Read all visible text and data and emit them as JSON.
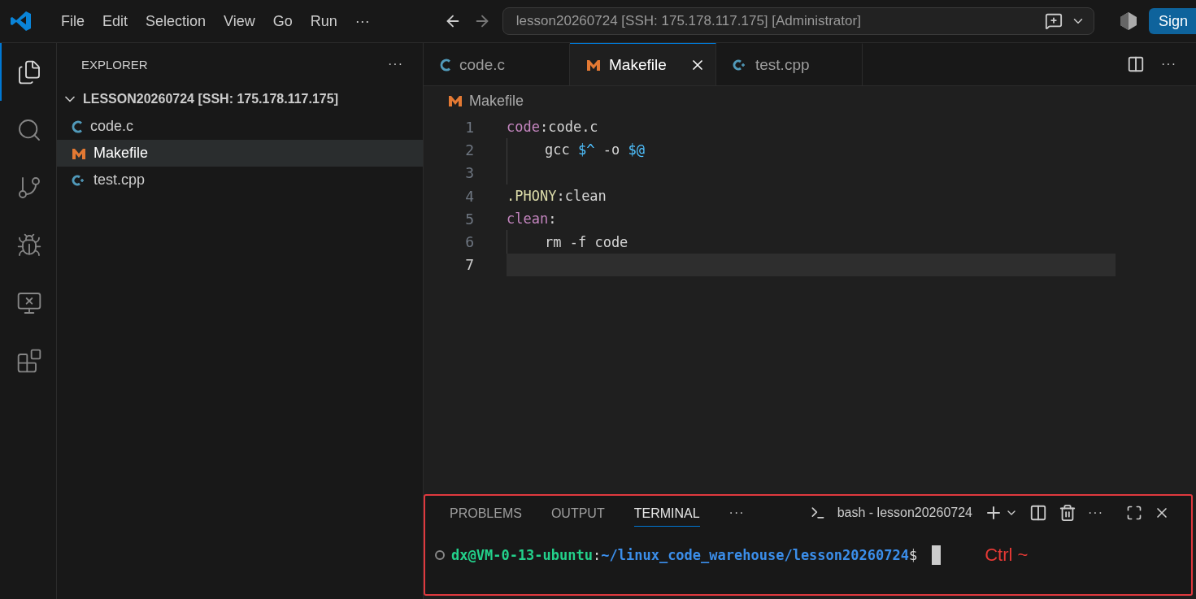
{
  "title_bar": {
    "menu": [
      "File",
      "Edit",
      "Selection",
      "View",
      "Go",
      "Run",
      "···"
    ],
    "command_center": "lesson20260724 [SSH: 175.178.117.175] [Administrator]",
    "sign_in": "Sign"
  },
  "activity_bar": [
    {
      "kind": "explorer",
      "selected": true
    },
    {
      "kind": "search",
      "selected": false
    },
    {
      "kind": "source-control",
      "selected": false
    },
    {
      "kind": "run-debug",
      "selected": false
    },
    {
      "kind": "remote",
      "selected": false
    },
    {
      "kind": "extensions",
      "selected": false
    }
  ],
  "sidebar": {
    "title": "EXPLORER",
    "more": "···",
    "folder": {
      "label": "LESSON20260724 [SSH: 175.178.117.175]",
      "expanded": true,
      "children": [
        {
          "label": "code.c",
          "kind": "c",
          "selected": false
        },
        {
          "label": "Makefile",
          "kind": "make",
          "selected": true
        },
        {
          "label": "test.cpp",
          "kind": "cpp",
          "selected": false
        }
      ]
    }
  },
  "editor": {
    "tabs": [
      {
        "label": "code.c",
        "kind": "c",
        "selected": false
      },
      {
        "label": "Makefile",
        "kind": "make",
        "selected": true
      },
      {
        "label": "test.cpp",
        "kind": "cpp",
        "selected": false
      }
    ],
    "more": "···",
    "breadcrumb": {
      "label": "Makefile",
      "kind": "make"
    },
    "lines": [
      {
        "number": "1",
        "indented": false,
        "current": false,
        "tokens": [
          {
            "text": "code",
            "kind": "target"
          },
          {
            "text": ":code.c",
            "kind": "plain"
          }
        ]
      },
      {
        "number": "2",
        "indented": true,
        "current": false,
        "tokens": [
          {
            "text": "gcc ",
            "kind": "plain"
          },
          {
            "text": "$^",
            "kind": "var"
          },
          {
            "text": " -o ",
            "kind": "plain"
          },
          {
            "text": "$@",
            "kind": "var"
          }
        ]
      },
      {
        "number": "3",
        "indented": true,
        "current": false
      },
      {
        "number": "4",
        "indented": false,
        "current": false,
        "tokens": [
          {
            "text": ".PHONY",
            "kind": "special"
          },
          {
            "text": ":clean",
            "kind": "plain"
          }
        ]
      },
      {
        "number": "5",
        "indented": false,
        "current": false,
        "tokens": [
          {
            "text": "clean",
            "kind": "target"
          },
          {
            "text": ":",
            "kind": "plain"
          }
        ]
      },
      {
        "number": "6",
        "indented": true,
        "current": false,
        "tokens": [
          {
            "text": "rm -f code",
            "kind": "plain"
          }
        ]
      },
      {
        "number": "7",
        "indented": false,
        "current": true
      }
    ]
  },
  "panel": {
    "tabs": [
      {
        "label": "PROBLEMS",
        "selected": false
      },
      {
        "label": "OUTPUT",
        "selected": false
      },
      {
        "label": "TERMINAL",
        "selected": true
      }
    ],
    "more": "···",
    "terminal_name": "bash - lesson20260724",
    "actions_more": "···",
    "prompt": [
      {
        "text": "dx@VM-0-13-ubuntu",
        "kind": "user"
      },
      {
        "text": ":",
        "kind": "plain"
      },
      {
        "text": "~/linux_code_warehouse/lesson20260724",
        "kind": "path"
      },
      {
        "text": "$",
        "kind": "plain"
      }
    ],
    "annotation": "Ctrl ~"
  }
}
